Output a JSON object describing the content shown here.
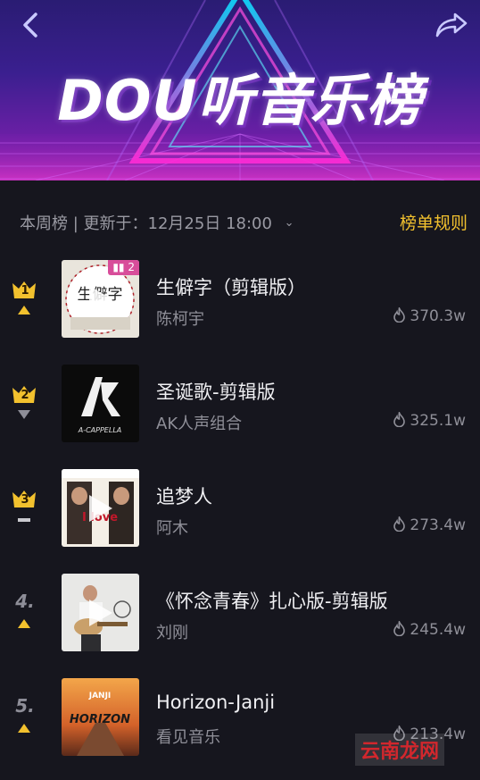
{
  "header": {
    "title": "DOU听音乐榜"
  },
  "meta": {
    "board_name": "本周榜",
    "separator": " | ",
    "update_label": "更新于：12月25日 18:00",
    "rules_label": "榜单规则"
  },
  "songs": [
    {
      "rank": "1",
      "title": "生僻字（剪辑版）",
      "artist": "陈柯宇",
      "heat": "370.3w",
      "trend": "up",
      "badge": "2",
      "cover_text": "生僻字"
    },
    {
      "rank": "2",
      "title": "圣诞歌-剪辑版",
      "artist": "AK人声组合",
      "heat": "325.1w",
      "trend": "down",
      "cover_text": "A-CAPPELLA"
    },
    {
      "rank": "3",
      "title": "追梦人",
      "artist": "阿木",
      "heat": "273.4w",
      "trend": "flat",
      "cover_text": "I love"
    },
    {
      "rank": "4.",
      "title": "《怀念青春》扎心版-剪辑版",
      "artist": "刘刚",
      "heat": "245.4w",
      "trend": "up"
    },
    {
      "rank": "5.",
      "title": "Horizon-Janji",
      "artist": "看见音乐",
      "heat": "213.4w",
      "trend": "up",
      "cover_text": "HORIZON",
      "cover_text2": "JANJI"
    }
  ],
  "watermark": {
    "brand": "云南龙网"
  },
  "colors": {
    "accent_yellow": "#f2c12e",
    "up": "#f2c12e",
    "down": "#8e8e98",
    "badge": "#d84d9a"
  }
}
